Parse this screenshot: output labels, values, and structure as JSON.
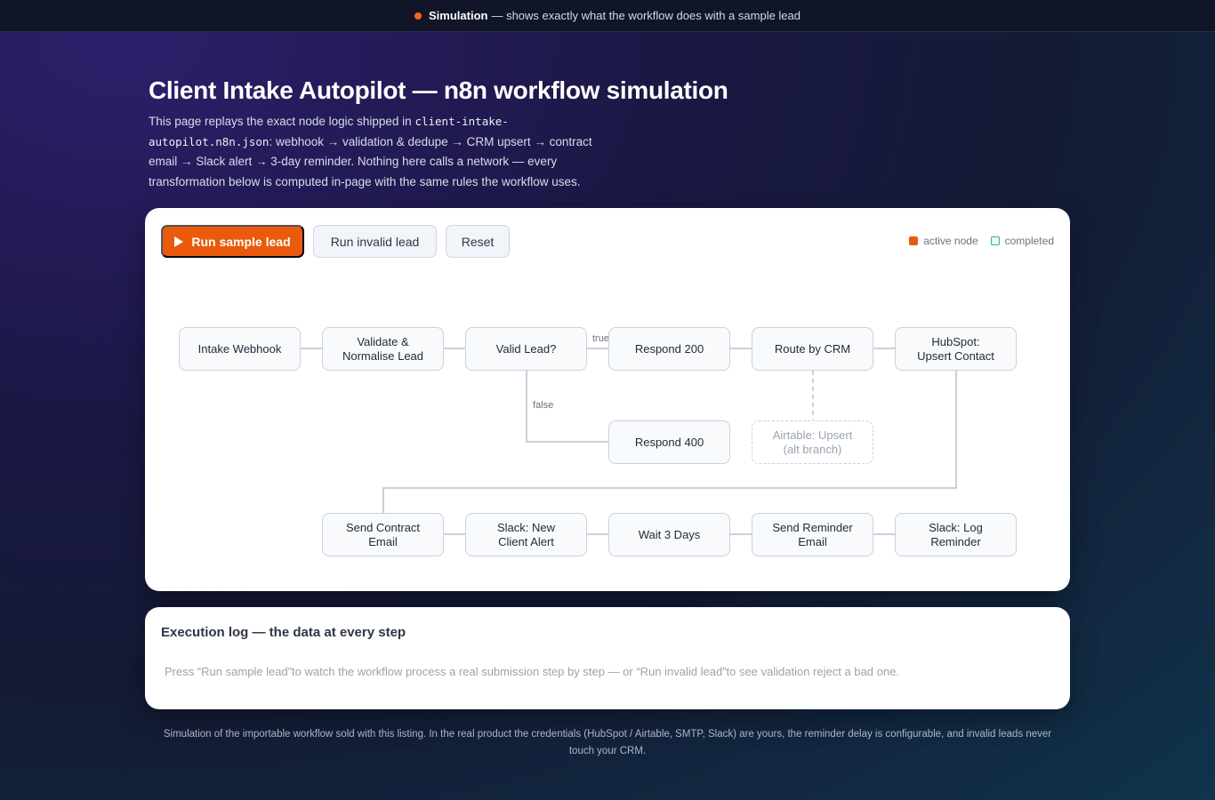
{
  "banner": {
    "label": "Simulation",
    "text": "— shows exactly what the workflow does with a sample lead"
  },
  "page": {
    "title": "Client Intake Autopilot — n8n workflow simulation",
    "intro_before": "This page replays the exact node logic shipped in ",
    "intro_file": "client-intake-autopilot.n8n.json",
    "intro_after": ": webhook → validation & dedupe → CRM upsert → contract email → Slack alert → 3-day reminder. Nothing here calls a network — every transformation below is computed in-page with the same rules the workflow uses."
  },
  "toolbar": {
    "run_sample": "Run sample lead",
    "run_invalid": "Run invalid lead",
    "reset": "Reset"
  },
  "legend": {
    "active": "active node",
    "completed": "completed"
  },
  "nodes": {
    "intake_webhook": "Intake Webhook",
    "validate": "Validate &\nNormalise Lead",
    "valid_lead": "Valid Lead?",
    "respond_200": "Respond 200",
    "route_crm": "Route by CRM",
    "hubspot": "HubSpot:\nUpsert Contact",
    "respond_400": "Respond 400",
    "airtable": "Airtable: Upsert\n(alt branch)",
    "send_contract": "Send Contract\nEmail",
    "slack_new": "Slack: New\nClient Alert",
    "wait": "Wait 3 Days",
    "send_reminder": "Send Reminder\nEmail",
    "slack_log": "Slack: Log\nReminder"
  },
  "edge_labels": {
    "true": "true",
    "false": "false"
  },
  "log": {
    "title": "Execution log — the data at every step",
    "placeholder": "Press “Run sample lead”to watch the workflow process a real submission step by step — or “Run invalid lead”to see validation reject a bad one."
  },
  "footer": "Simulation of the importable workflow sold with this listing. In the real product the credentials (HubSpot / Airtable, SMTP, Slack) are yours, the reminder delay is configurable, and invalid leads never touch your CRM.",
  "colors": {
    "accent": "#ea5a0c",
    "completed": "#2fb39a"
  }
}
